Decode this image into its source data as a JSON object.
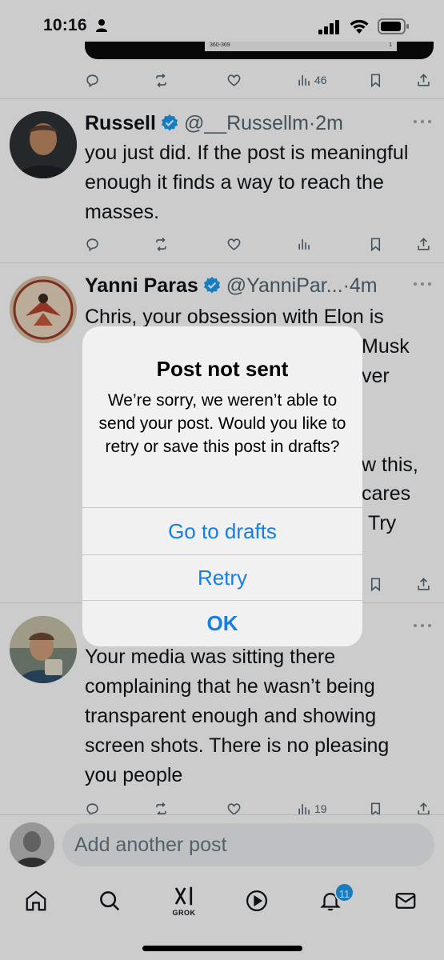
{
  "status_bar": {
    "time": "10:16"
  },
  "top_media": {
    "label_left": "360-369",
    "label_right": "1"
  },
  "tweets": [
    {
      "id": "prev",
      "views": "46"
    },
    {
      "id": "russell",
      "name": "Russell",
      "handle": "@__Russellm",
      "sep": "·",
      "time": "2m",
      "text": "you just did. If the post is meaningful enough it finds a way to reach the masses."
    },
    {
      "id": "yanni",
      "name": "Yanni Paras",
      "handle": "@YanniPar...",
      "sep": "·",
      "time": "4m",
      "lines": [
        "Chris, your obsession with Elon is",
        "Musk",
        "ver",
        "",
        "w this,",
        "cares",
        "Try"
      ]
    },
    {
      "id": "third",
      "text_lines": [
        "Your media was sitting there",
        "complaining that he wasn’t being",
        "transparent enough and showing",
        "screen shots. There is no pleasing",
        "you people"
      ],
      "views": "19"
    }
  ],
  "composer": {
    "placeholder": "Add another post"
  },
  "tabbar": {
    "grok_label": "GROK",
    "notifications_count": "11"
  },
  "alert": {
    "title": "Post not sent",
    "message": "We’re sorry, we weren’t able to send your post. Would you like to retry or save this post in drafts?",
    "buttons": {
      "drafts": "Go to drafts",
      "retry": "Retry",
      "ok": "OK"
    }
  },
  "colors": {
    "accent": "#1d9bf0",
    "alert_button": "#157ee8",
    "secondary_text": "#536471"
  }
}
